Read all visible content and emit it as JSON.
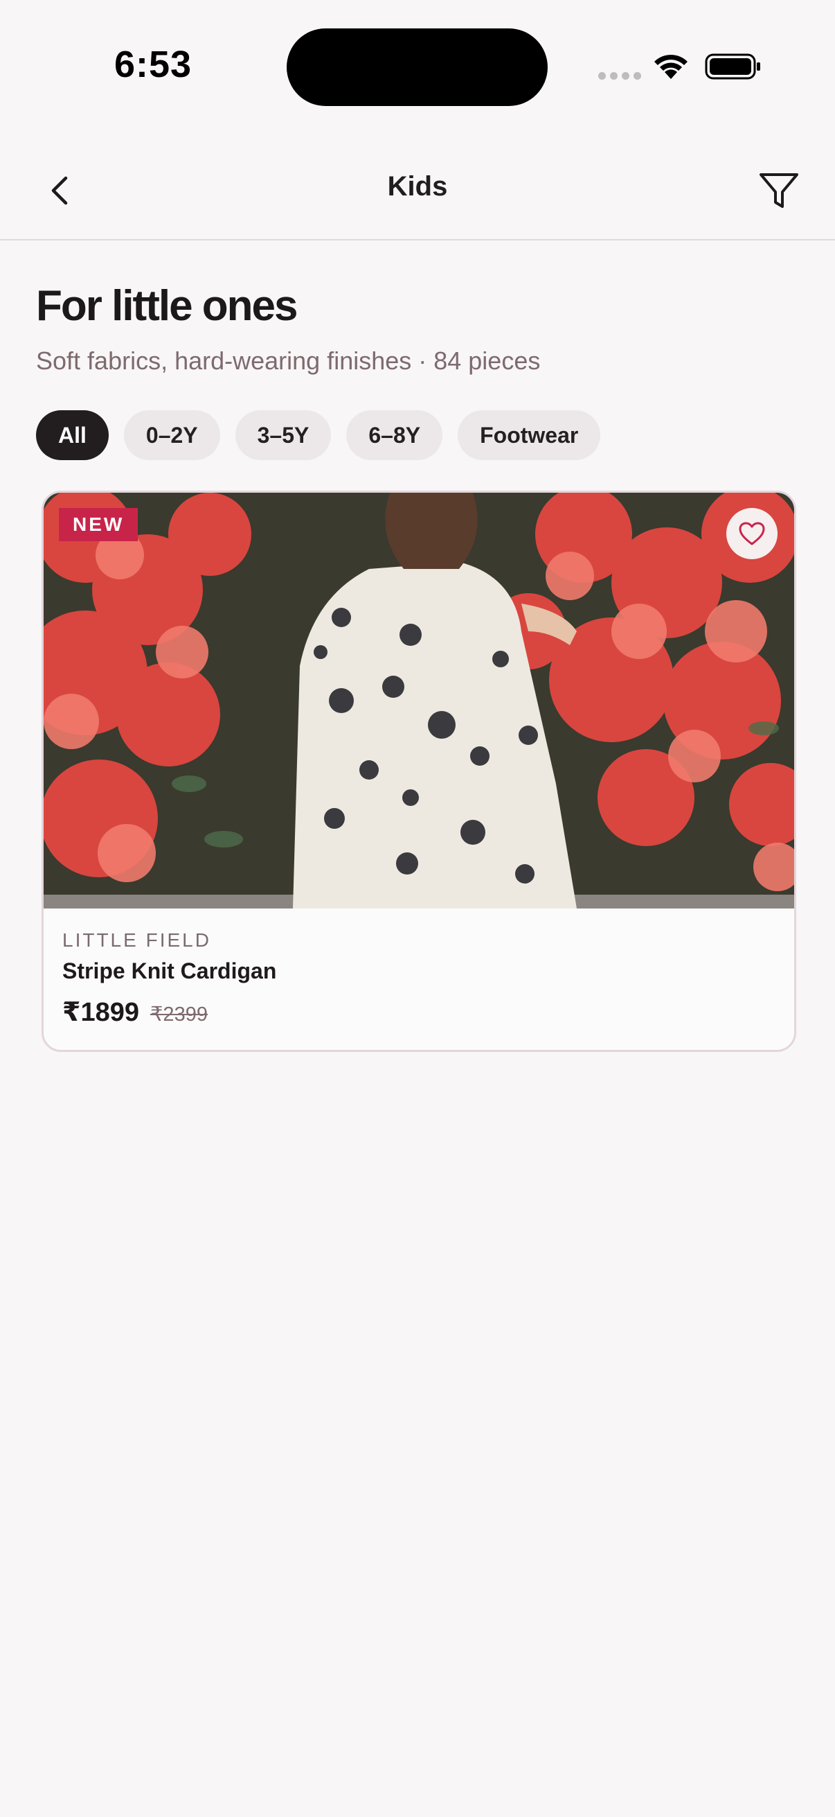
{
  "status_bar": {
    "time": "6:53"
  },
  "nav": {
    "title": "Kids"
  },
  "header": {
    "title": "For little ones",
    "subtitle": "Soft fabrics, hard-wearing finishes · 84 pieces"
  },
  "chips": [
    {
      "label": "All",
      "active": true
    },
    {
      "label": "0–2Y",
      "active": false
    },
    {
      "label": "3–5Y",
      "active": false
    },
    {
      "label": "6–8Y",
      "active": false
    },
    {
      "label": "Footwear",
      "active": false
    }
  ],
  "products": [
    {
      "badge": "NEW",
      "brand": "LITTLE FIELD",
      "name": "Stripe Knit Cardigan",
      "price": "₹1899",
      "old_price": "₹2399",
      "favorite_icon": "heart-outline-icon"
    }
  ],
  "colors": {
    "accent": "#c8244a",
    "chip_active_bg": "#221d1e",
    "chip_bg": "#ece8e9",
    "muted_text": "#7d6a6f",
    "background": "#f8f6f7"
  },
  "icons": {
    "back": "chevron-left-icon",
    "filter": "funnel-icon",
    "wifi": "wifi-icon",
    "battery": "battery-icon",
    "signal": "cellular-signal-icon"
  }
}
